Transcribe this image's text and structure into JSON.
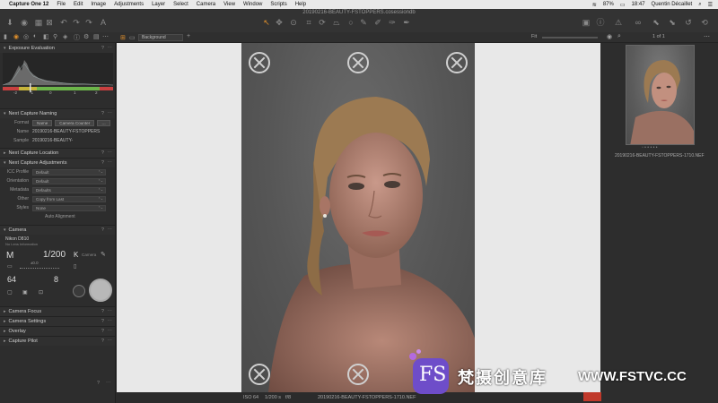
{
  "menubar": {
    "app": "Capture One 12",
    "items": [
      "File",
      "Edit",
      "Image",
      "Adjustments",
      "Layer",
      "Select",
      "Camera",
      "View",
      "Window",
      "Scripts",
      "Help"
    ],
    "battery": "87%",
    "time": "18:47",
    "user": "Quentin Décaillet"
  },
  "toolbar": {
    "title": "20190216-BEAUTY-FSTOPPERS.cosessiondb"
  },
  "subbar": {
    "layer": "Background",
    "fit": "Fit",
    "page_count": "1 of 1"
  },
  "left": {
    "exposure_title": "Exposure Evaluation",
    "histo_ticks": [
      "-2",
      "-1",
      "0",
      "1",
      "2"
    ],
    "naming_title": "Next Capture Naming",
    "format_label": "Format",
    "format_btn1": "Name",
    "format_btn2": "Camera Counter",
    "name_label": "Name",
    "name_value": "20190216-BEAUTY-FSTOPPERS",
    "sample_label": "Sample",
    "sample_value": "20190216-BEAUTY-",
    "location_title": "Next Capture Location",
    "adjust_title": "Next Capture Adjustments",
    "adjust_rows": [
      {
        "label": "ICC Profile",
        "value": "Default"
      },
      {
        "label": "Orientation",
        "value": "Default"
      },
      {
        "label": "Metadata",
        "value": "Defaults"
      },
      {
        "label": "Other",
        "value": "Copy from Last"
      },
      {
        "label": "Styles",
        "value": "None"
      }
    ],
    "auto_alignment": "Auto Alignment",
    "camera_title": "Camera",
    "camera_model": "Nikon D810",
    "lens_info": "No Lens Information",
    "mode": "M",
    "shutter": "1/200",
    "kelvin_label": "K",
    "kelvin_value": "Camera",
    "iso": "64",
    "aperture": "8",
    "exposure_comp": "±0.0",
    "collapsed_sections": [
      "Camera Focus",
      "Camera Settings",
      "Overlay",
      "Capture Pilot"
    ]
  },
  "status": {
    "iso": "ISO 64",
    "shutter": "1/200 s",
    "aperture": "f/8",
    "filename": "20190216-BEAUTY-FSTOPPERS-1710.NEF"
  },
  "right": {
    "thumb_caption": "20190216-BEAUTY-FSTOPPERS-1710.NEF"
  },
  "watermark": {
    "logo_text": "FS",
    "chinese": "梵摄创意库",
    "url": "WWW.FSTVC.CC"
  }
}
